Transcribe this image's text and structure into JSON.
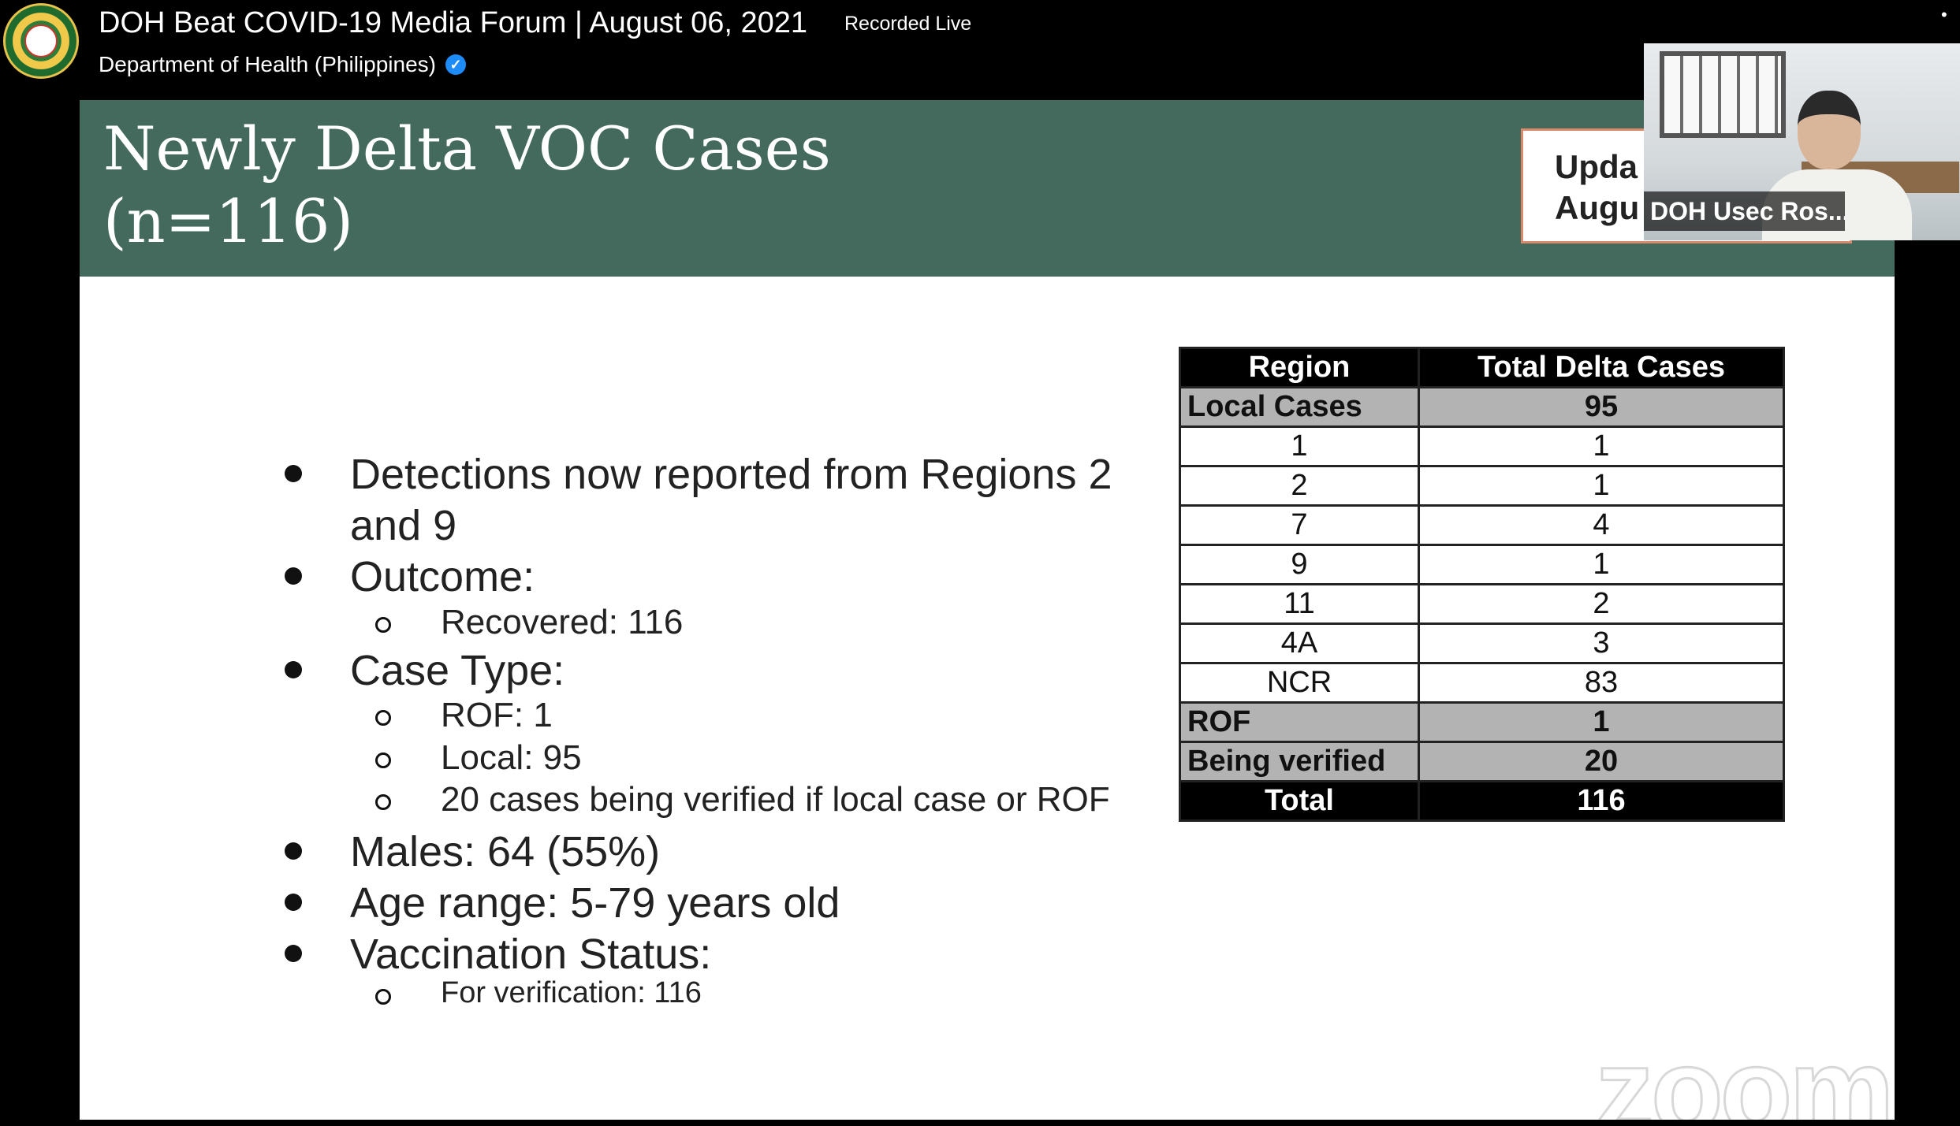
{
  "header": {
    "title": "DOH Beat COVID-19 Media Forum | August 06, 2021",
    "status": "Recorded Live",
    "channel": "Department of Health (Philippines)",
    "verified_icon": "verified-checkmark"
  },
  "slide": {
    "title_line1": "Newly Delta VOC Cases",
    "title_line2": "(n=116)",
    "updated_text": "Upda\nAugu",
    "bullets": {
      "detections_1": "Detections now reported from Regions 2",
      "detections_2": "and 9",
      "outcome": "Outcome:",
      "recovered": "Recovered: 116",
      "case_type": "Case Type:",
      "rof": "ROF: 1",
      "local": "Local: 95",
      "verifying": "20 cases being verified if local case or ROF",
      "males": "Males: 64 (55%)",
      "age": "Age range: 5-79 years old",
      "vaccination": "Vaccination Status:",
      "for_verification": "For verification: 116"
    },
    "table": {
      "headers": [
        "Region",
        "Total Delta Cases"
      ],
      "rows": [
        {
          "region": "Local Cases",
          "cases": "95",
          "style": "grey"
        },
        {
          "region": "1",
          "cases": "1",
          "style": "plain"
        },
        {
          "region": "2",
          "cases": "1",
          "style": "plain"
        },
        {
          "region": "7",
          "cases": "4",
          "style": "plain"
        },
        {
          "region": "9",
          "cases": "1",
          "style": "plain"
        },
        {
          "region": "11",
          "cases": "2",
          "style": "plain"
        },
        {
          "region": "4A",
          "cases": "3",
          "style": "plain"
        },
        {
          "region": "NCR",
          "cases": "83",
          "style": "plain"
        },
        {
          "region": "ROF",
          "cases": "1",
          "style": "grey"
        },
        {
          "region": "Being verified",
          "cases": "20",
          "style": "grey"
        }
      ],
      "total": {
        "region": "Total",
        "cases": "116"
      }
    },
    "watermark": "zoom"
  },
  "speaker": {
    "name": "DOH Usec Ros..."
  }
}
